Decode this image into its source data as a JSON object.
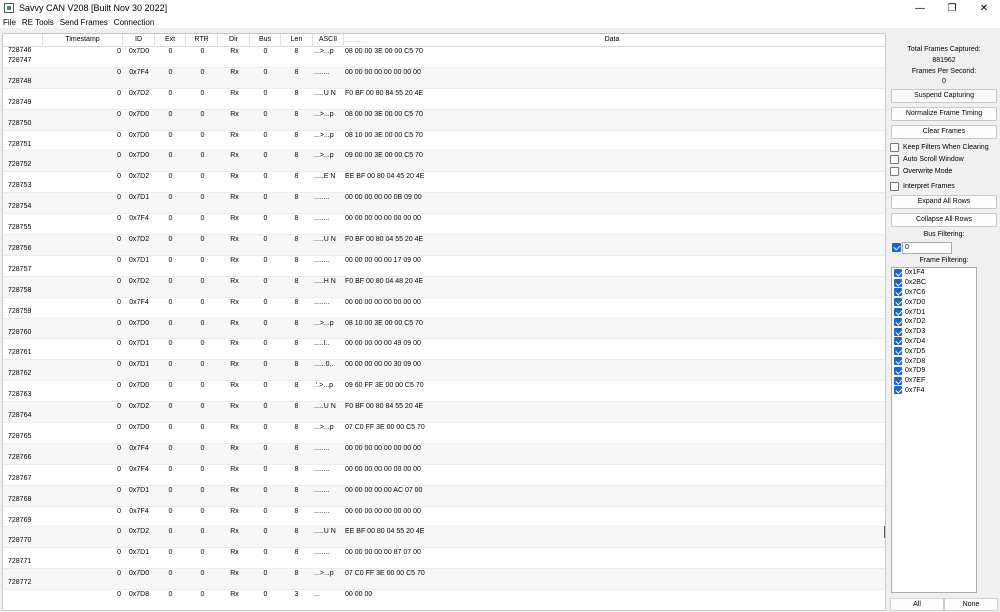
{
  "window": {
    "title": "Savvy CAN V208 [Built Nov 30 2022]",
    "controls": {
      "minimize": "—",
      "maximize": "❐",
      "close": "✕"
    }
  },
  "menu": [
    "File",
    "RE Tools",
    "Send Frames",
    "Connection"
  ],
  "table": {
    "columns": [
      "Timestamp",
      "ID",
      "Ext",
      "RTR",
      "Dir",
      "Bus",
      "Len",
      "ASCII",
      "Data"
    ],
    "first_row": {
      "rownum": "728746",
      "data": "·· ·· ·· ··"
    },
    "rows": [
      {
        "rownum": "728747",
        "ts": "0",
        "id": "0x7D0",
        "ext": "0",
        "rtr": "0",
        "dir": "Rx",
        "bus": "0",
        "len": "8",
        "ascii": "...>...p",
        "data": "08 00 00 3E 00 00 C5 70"
      },
      {
        "rownum": "728748",
        "ts": "0",
        "id": "0x7F4",
        "ext": "0",
        "rtr": "0",
        "dir": "Rx",
        "bus": "0",
        "len": "8",
        "ascii": "........",
        "data": "00 00 00 00 00 00 00 00"
      },
      {
        "rownum": "728749",
        "ts": "0",
        "id": "0x7D2",
        "ext": "0",
        "rtr": "0",
        "dir": "Rx",
        "bus": "0",
        "len": "8",
        "ascii": ".....U N",
        "data": "F0 BF 00 80 84 55 20 4E"
      },
      {
        "rownum": "728750",
        "ts": "0",
        "id": "0x7D0",
        "ext": "0",
        "rtr": "0",
        "dir": "Rx",
        "bus": "0",
        "len": "8",
        "ascii": "...>...p",
        "data": "08 00 00 3E 00 00 C5 70"
      },
      {
        "rownum": "728751",
        "ts": "0",
        "id": "0x7D0",
        "ext": "0",
        "rtr": "0",
        "dir": "Rx",
        "bus": "0",
        "len": "8",
        "ascii": "...>...p",
        "data": "08 10 00 3E 00 00 C5 70"
      },
      {
        "rownum": "728752",
        "ts": "0",
        "id": "0x7D0",
        "ext": "0",
        "rtr": "0",
        "dir": "Rx",
        "bus": "0",
        "len": "8",
        "ascii": "...>...p",
        "data": "09 00 00 3E 00 00 C5 70"
      },
      {
        "rownum": "728753",
        "ts": "0",
        "id": "0x7D2",
        "ext": "0",
        "rtr": "0",
        "dir": "Rx",
        "bus": "0",
        "len": "8",
        "ascii": ".....E N",
        "data": "EE BF 00 80 04 45 20 4E"
      },
      {
        "rownum": "728754",
        "ts": "0",
        "id": "0x7D1",
        "ext": "0",
        "rtr": "0",
        "dir": "Rx",
        "bus": "0",
        "len": "8",
        "ascii": "........",
        "data": "00 00 00 00 00 0B 09 00"
      },
      {
        "rownum": "728755",
        "ts": "0",
        "id": "0x7F4",
        "ext": "0",
        "rtr": "0",
        "dir": "Rx",
        "bus": "0",
        "len": "8",
        "ascii": "........",
        "data": "00 00 00 00 00 00 00 00"
      },
      {
        "rownum": "728756",
        "ts": "0",
        "id": "0x7D2",
        "ext": "0",
        "rtr": "0",
        "dir": "Rx",
        "bus": "0",
        "len": "8",
        "ascii": ".....U N",
        "data": "F0 BF 00 80 04 55 20 4E"
      },
      {
        "rownum": "728757",
        "ts": "0",
        "id": "0x7D1",
        "ext": "0",
        "rtr": "0",
        "dir": "Rx",
        "bus": "0",
        "len": "8",
        "ascii": "........",
        "data": "00 00 00 00 00 17 09 00"
      },
      {
        "rownum": "728758",
        "ts": "0",
        "id": "0x7D2",
        "ext": "0",
        "rtr": "0",
        "dir": "Rx",
        "bus": "0",
        "len": "8",
        "ascii": ".....H N",
        "data": "F0 BF 00 80 04 48 20 4E"
      },
      {
        "rownum": "728759",
        "ts": "0",
        "id": "0x7F4",
        "ext": "0",
        "rtr": "0",
        "dir": "Rx",
        "bus": "0",
        "len": "8",
        "ascii": "........",
        "data": "00 00 00 00 00 00 00 00"
      },
      {
        "rownum": "728760",
        "ts": "0",
        "id": "0x7D0",
        "ext": "0",
        "rtr": "0",
        "dir": "Rx",
        "bus": "0",
        "len": "8",
        "ascii": "...>...p",
        "data": "08 10 00 3E 00 00 C5 70"
      },
      {
        "rownum": "728761",
        "ts": "0",
        "id": "0x7D1",
        "ext": "0",
        "rtr": "0",
        "dir": "Rx",
        "bus": "0",
        "len": "8",
        "ascii": ".....I..",
        "data": "00 00 00 00 00 49 09 00"
      },
      {
        "rownum": "728762",
        "ts": "0",
        "id": "0x7D1",
        "ext": "0",
        "rtr": "0",
        "dir": "Rx",
        "bus": "0",
        "len": "8",
        "ascii": "......0..",
        "data": "00 00 00 00 00 30 09 00"
      },
      {
        "rownum": "728763",
        "ts": "0",
        "id": "0x7D0",
        "ext": "0",
        "rtr": "0",
        "dir": "Rx",
        "bus": "0",
        "len": "8",
        "ascii": ".'.>...p",
        "data": "09 60 FF 3E 00 00 C5 70"
      },
      {
        "rownum": "728764",
        "ts": "0",
        "id": "0x7D2",
        "ext": "0",
        "rtr": "0",
        "dir": "Rx",
        "bus": "0",
        "len": "8",
        "ascii": ".....U N",
        "data": "F0 BF 00 80 84 55 20 4E"
      },
      {
        "rownum": "728765",
        "ts": "0",
        "id": "0x7D0",
        "ext": "0",
        "rtr": "0",
        "dir": "Rx",
        "bus": "0",
        "len": "8",
        "ascii": "...>...p",
        "data": "07 C0 FF 3E 00 00 C5 70"
      },
      {
        "rownum": "728766",
        "ts": "0",
        "id": "0x7F4",
        "ext": "0",
        "rtr": "0",
        "dir": "Rx",
        "bus": "0",
        "len": "8",
        "ascii": "........",
        "data": "00 00 00 00 00 00 00 00"
      },
      {
        "rownum": "728767",
        "ts": "0",
        "id": "0x7F4",
        "ext": "0",
        "rtr": "0",
        "dir": "Rx",
        "bus": "0",
        "len": "8",
        "ascii": "........",
        "data": "00 00 00 00 00 00 00 00"
      },
      {
        "rownum": "728768",
        "ts": "0",
        "id": "0x7D1",
        "ext": "0",
        "rtr": "0",
        "dir": "Rx",
        "bus": "0",
        "len": "8",
        "ascii": "........",
        "data": "00 00 00 00 00 AC 07 00"
      },
      {
        "rownum": "728769",
        "ts": "0",
        "id": "0x7F4",
        "ext": "0",
        "rtr": "0",
        "dir": "Rx",
        "bus": "0",
        "len": "8",
        "ascii": "........",
        "data": "00 00 00 00 00 00 00 00"
      },
      {
        "rownum": "728770",
        "ts": "0",
        "id": "0x7D2",
        "ext": "0",
        "rtr": "0",
        "dir": "Rx",
        "bus": "0",
        "len": "8",
        "ascii": ".....U N",
        "data": "EE BF 00 80 04 55 20 4E"
      },
      {
        "rownum": "728771",
        "ts": "0",
        "id": "0x7D1",
        "ext": "0",
        "rtr": "0",
        "dir": "Rx",
        "bus": "0",
        "len": "8",
        "ascii": "........",
        "data": "00 00 00 00 00 87 07 00"
      },
      {
        "rownum": "728772",
        "ts": "0",
        "id": "0x7D0",
        "ext": "0",
        "rtr": "0",
        "dir": "Rx",
        "bus": "0",
        "len": "8",
        "ascii": "...>...p",
        "data": "07 C0 FF 3E 00 00 C5 70"
      },
      {
        "rownum": "",
        "ts": "0",
        "id": "0x7D8",
        "ext": "0",
        "rtr": "0",
        "dir": "Rx",
        "bus": "0",
        "len": "3",
        "ascii": "...",
        "data": "00 00 00"
      }
    ]
  },
  "sidebar": {
    "total_frames_label": "Total Frames Captured:",
    "total_frames_value": "881962",
    "fps_label": "Frames Per Second:",
    "fps_value": "0",
    "buttons": {
      "suspend": "Suspend Capturing",
      "normalize": "Normalize Frame Timing",
      "clear": "Clear Frames",
      "expand": "Expand All Rows",
      "collapse": "Collapse All Rows"
    },
    "checkboxes": {
      "keep_filters": {
        "label": "Keep Filters When Clearing",
        "checked": false
      },
      "auto_scroll": {
        "label": "Auto Scroll Window",
        "checked": false
      },
      "overwrite": {
        "label": "Overwrite Mode",
        "checked": false
      },
      "interpret": {
        "label": "Interpret Frames",
        "checked": false
      }
    },
    "bus_filtering_label": "Bus Filtering:",
    "bus_value": "0",
    "frame_filtering_label": "Frame Filtering:",
    "frame_filters": [
      "0x1F4",
      "0x2BC",
      "0x7C6",
      "0x7D0",
      "0x7D1",
      "0x7D2",
      "0x7D3",
      "0x7D4",
      "0x7D5",
      "0x7D8",
      "0x7D9",
      "0x7EF",
      "0x7F4"
    ],
    "all_label": "All",
    "none_label": "None"
  },
  "colors": {
    "accent": "#1a66c9"
  }
}
